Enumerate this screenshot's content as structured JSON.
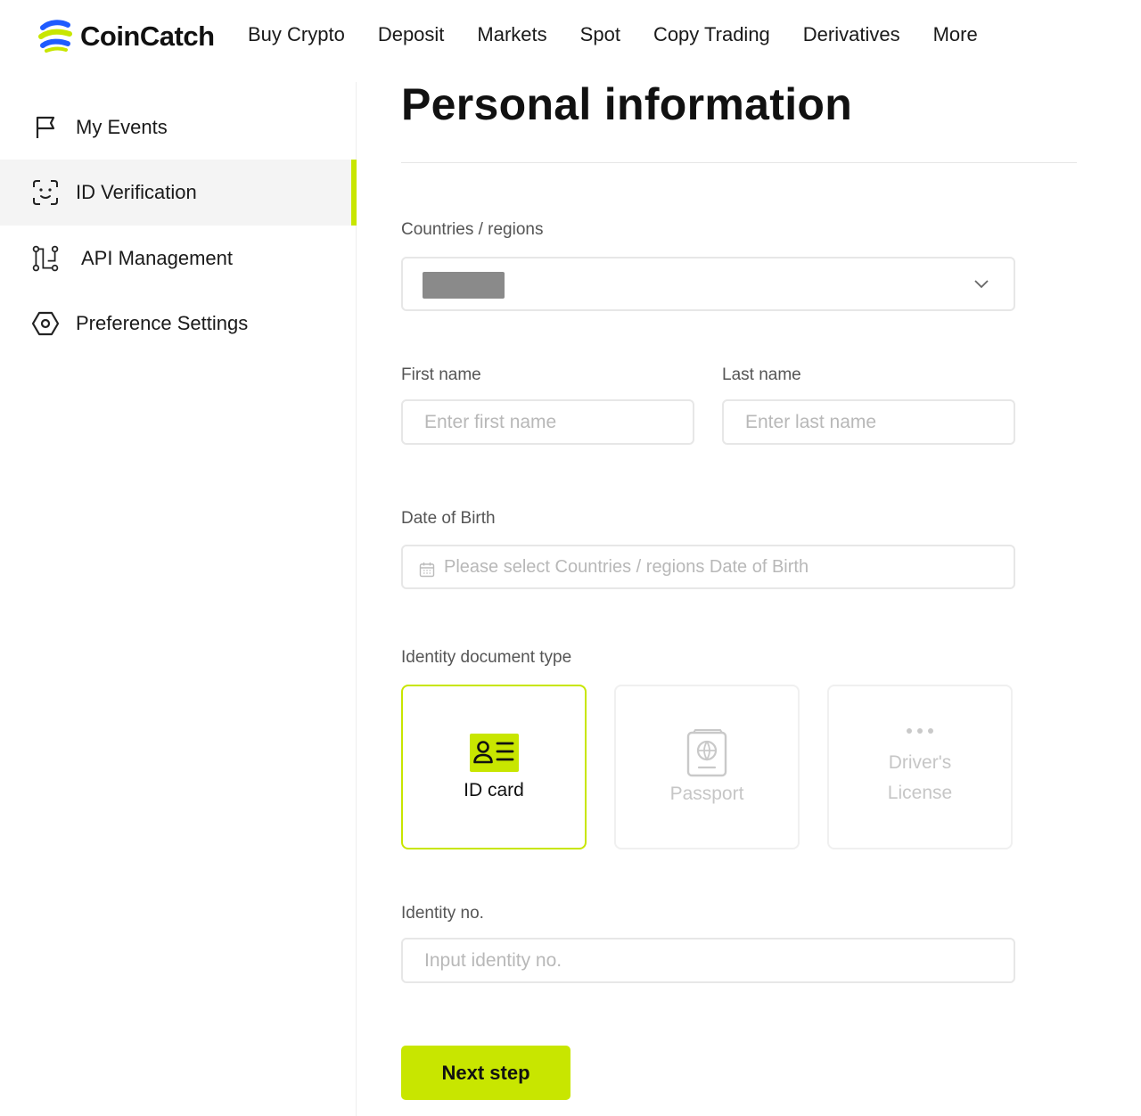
{
  "brand": {
    "name": "CoinCatch",
    "colors": {
      "accent": "#c8e600",
      "blue": "#1f5bff",
      "dark": "#111111"
    }
  },
  "nav": {
    "items": [
      "Buy Crypto",
      "Deposit",
      "Markets",
      "Spot",
      "Copy Trading",
      "Derivatives",
      "More"
    ]
  },
  "sidebar": {
    "items": [
      {
        "label": "My Events",
        "icon": "flag-icon",
        "active": false
      },
      {
        "label": "ID Verification",
        "icon": "face-scan-icon",
        "active": true
      },
      {
        "label": "API Management",
        "icon": "api-nodes-icon",
        "active": false
      },
      {
        "label": "Preference Settings",
        "icon": "hexagon-gear-icon",
        "active": false
      }
    ]
  },
  "page": {
    "title": "Personal information"
  },
  "form": {
    "country": {
      "label": "Countries / regions",
      "icon": "chevron-down-icon"
    },
    "first_name": {
      "label": "First name",
      "placeholder": "Enter first name"
    },
    "last_name": {
      "label": "Last name",
      "placeholder": "Enter last name"
    },
    "dob": {
      "label": "Date of Birth",
      "placeholder": "Please select Countries / regions Date of Birth",
      "icon": "calendar-icon"
    },
    "doc_type": {
      "label": "Identity document type",
      "options": [
        {
          "label": "ID card",
          "icon": "id-card-icon",
          "selected": true
        },
        {
          "label": "Passport",
          "icon": "passport-icon",
          "selected": false
        },
        {
          "label": "Driver's License",
          "icon": "more-dots-icon",
          "selected": false
        }
      ]
    },
    "identity_no": {
      "label": "Identity no.",
      "placeholder": "Input identity no."
    },
    "next_label": "Next step"
  }
}
